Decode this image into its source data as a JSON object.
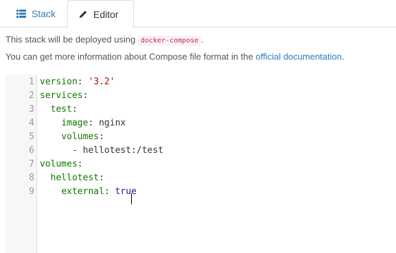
{
  "tabs": [
    {
      "label": "Stack",
      "icon": "list-icon"
    },
    {
      "label": "Editor",
      "icon": "pencil-icon"
    }
  ],
  "info": {
    "deploy_prefix": "This stack will be deployed using",
    "deploy_code": "docker-compose",
    "deploy_suffix": ".",
    "more_prefix": "You can get more information about Compose file format in the",
    "more_link": "official documentation",
    "more_suffix": "."
  },
  "editor": {
    "line_numbers": [
      "1",
      "2",
      "3",
      "4",
      "5",
      "6",
      "7",
      "8",
      "9"
    ],
    "lines": [
      {
        "indent": "",
        "key": "version",
        "sep": ": ",
        "value": "'3.2'",
        "vtype": "s"
      },
      {
        "indent": "",
        "key": "services",
        "sep": ":",
        "value": "",
        "vtype": ""
      },
      {
        "indent": "  ",
        "key": "test",
        "sep": ":",
        "value": "",
        "vtype": ""
      },
      {
        "indent": "    ",
        "key": "image",
        "sep": ": ",
        "value": "nginx",
        "vtype": "p"
      },
      {
        "indent": "    ",
        "key": "volumes",
        "sep": ":",
        "value": "",
        "vtype": ""
      },
      {
        "indent": "      ",
        "key": "- hellotest:/test",
        "sep": "",
        "value": "",
        "vtype": "plain"
      },
      {
        "indent": "",
        "key": "volumes",
        "sep": ":",
        "value": "",
        "vtype": ""
      },
      {
        "indent": "  ",
        "key": "hellotest",
        "sep": ":",
        "value": "",
        "vtype": ""
      },
      {
        "indent": "    ",
        "key": "external",
        "sep": ": ",
        "value": "true",
        "vtype": "a"
      }
    ]
  }
}
